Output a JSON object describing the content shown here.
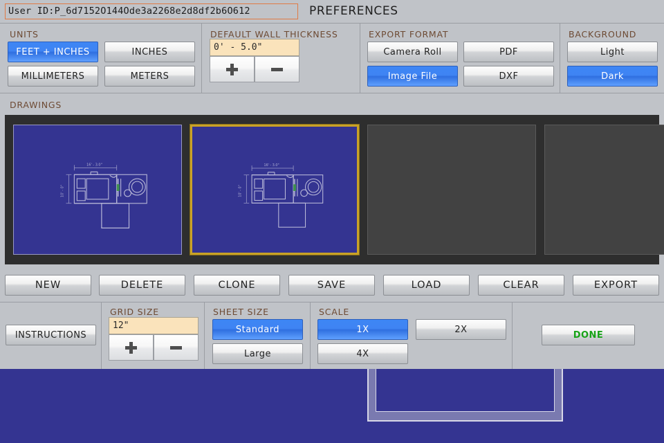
{
  "header": {
    "user_id": "User ID:P_6d7152O144Ode3a2268e2d8df2b6O612",
    "title": "PREFERENCES"
  },
  "colors": {
    "panel_bg": "#c0c3c8",
    "accent_selected": "#3e86f5",
    "group_title": "#6d4a33",
    "value_field_bg": "#fae3bb",
    "canvas_blue": "#343491",
    "tray_bg": "#2e2e2e",
    "selection_gold": "#c9a227",
    "done_green": "#17a317",
    "userid_border": "#e07a45"
  },
  "units": {
    "title": "UNITS",
    "options": [
      {
        "label": "FEET + INCHES",
        "selected": true
      },
      {
        "label": "INCHES",
        "selected": false
      },
      {
        "label": "MILLIMETERS",
        "selected": false
      },
      {
        "label": "METERS",
        "selected": false
      }
    ]
  },
  "wall_thickness": {
    "title": "DEFAULT WALL THICKNESS",
    "value": "0' - 5.0\"",
    "increment_label": "+",
    "decrement_label": "−"
  },
  "export_format": {
    "title": "EXPORT FORMAT",
    "options": [
      {
        "label": "Camera Roll",
        "selected": false
      },
      {
        "label": "PDF",
        "selected": false
      },
      {
        "label": "Image File",
        "selected": true
      },
      {
        "label": "DXF",
        "selected": false
      }
    ]
  },
  "background": {
    "title": "BACKGROUND",
    "options": [
      {
        "label": "Light",
        "selected": false
      },
      {
        "label": "Dark",
        "selected": true
      }
    ]
  },
  "drawings": {
    "title": "DRAWINGS",
    "slots": [
      {
        "filled": true,
        "selected": false,
        "dimension_top": "16' - 3.0\"",
        "dimension_left": "10' - 0\""
      },
      {
        "filled": true,
        "selected": true,
        "dimension_top": "16' - 3.0\"",
        "dimension_left": "10' - 0\""
      },
      {
        "filled": false,
        "selected": false
      },
      {
        "filled": false,
        "selected": false
      }
    ]
  },
  "actions": [
    {
      "label": "NEW"
    },
    {
      "label": "DELETE"
    },
    {
      "label": "CLONE"
    },
    {
      "label": "SAVE"
    },
    {
      "label": "LOAD"
    },
    {
      "label": "CLEAR"
    },
    {
      "label": "EXPORT"
    }
  ],
  "instructions": {
    "label": "INSTRUCTIONS"
  },
  "grid_size": {
    "title": "GRID SIZE",
    "value": "12\"",
    "increment_label": "+",
    "decrement_label": "−"
  },
  "sheet_size": {
    "title": "SHEET SIZE",
    "options": [
      {
        "label": "Standard",
        "selected": true
      },
      {
        "label": "Large",
        "selected": false
      }
    ]
  },
  "scale": {
    "title": "SCALE",
    "options": [
      {
        "label": "1X",
        "selected": true
      },
      {
        "label": "2X",
        "selected": false
      },
      {
        "label": "4X",
        "selected": false
      }
    ]
  },
  "done": {
    "label": "DONE"
  }
}
